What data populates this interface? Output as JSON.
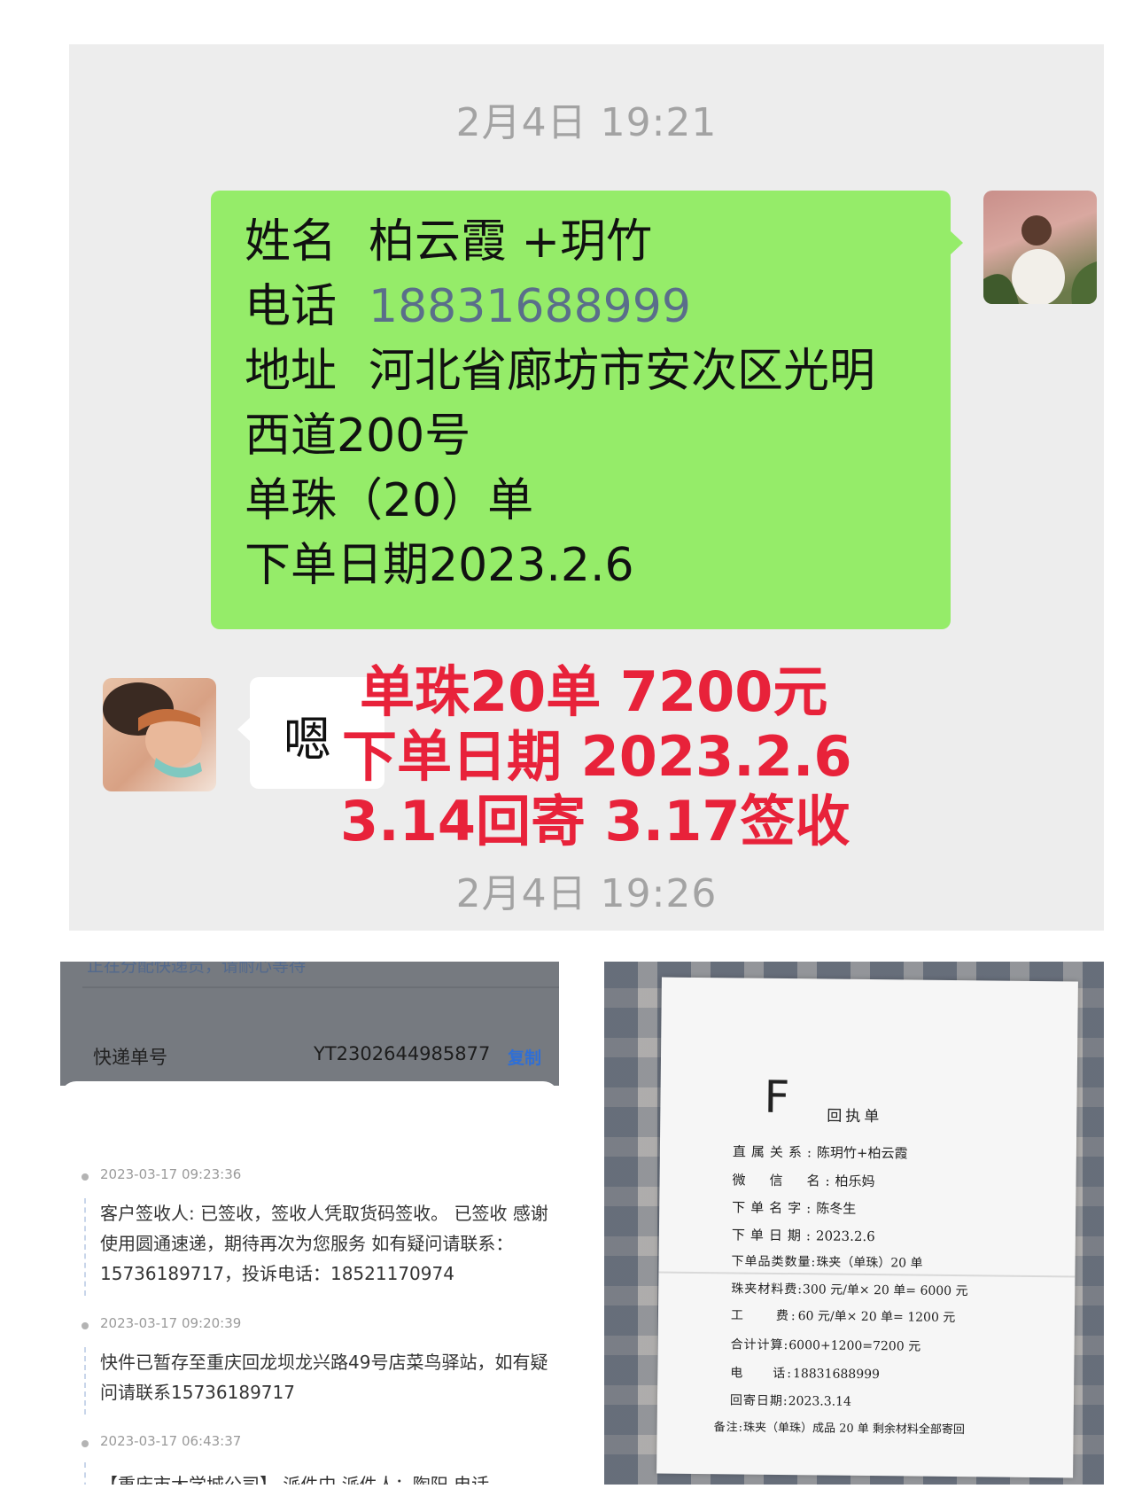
{
  "chat": {
    "timestamp_top": "2月4日 19:21",
    "outgoing": {
      "name_key": "姓名",
      "name_value": "柏云霞 +玥竹",
      "phone_key": "电话",
      "phone_value": "18831688999",
      "address_key": "地址",
      "address_value_line1": "河北省廊坊市安次区光明",
      "address_value_line2": "西道200号",
      "item_line": "单珠（20）单",
      "order_date_line": "下单日期2023.2.6"
    },
    "incoming_text": "嗯",
    "annotation": {
      "line1": "单珠20单 7200元",
      "line2": "下单日期 2023.2.6",
      "line3": "3.14回寄 3.17签收"
    },
    "timestamp_bottom": "2月4日 19:26"
  },
  "logistics": {
    "cut_text": "正在分配快递员，请耐心等待",
    "tracking_label": "快递单号",
    "tracking_number": "YT2302644985877",
    "copy_label": "复制",
    "events": [
      {
        "time": "2023-03-17 09:23:36",
        "text": "客户签收人: 已签收，签收人凭取货码签收。 已签收 感谢使用圆通速递，期待再次为您服务 如有疑问请联系：15736189717，投诉电话：18521170974"
      },
      {
        "time": "2023-03-17 09:20:39",
        "text": "快件已暂存至重庆回龙坝龙兴路49号店菜鸟驿站，如有疑问请联系15736189717"
      },
      {
        "time": "2023-03-17 06:43:37",
        "text": "【重庆市大学城公司】 派件中 派件人：陶阳 电话"
      }
    ]
  },
  "receipt": {
    "letter": "F",
    "heading": "回执单",
    "rows": [
      {
        "k": "直属关系:",
        "v": "陈玥竹+柏云霞"
      },
      {
        "k": "微　信　名:",
        "v": "柏乐妈"
      },
      {
        "k": "下单名字:",
        "v": "陈冬生"
      },
      {
        "k": "下单日期:",
        "v": "2023.2.6"
      },
      {
        "k": "下单品类数量:",
        "v": "珠夹（单珠）20 单"
      },
      {
        "k": "珠夹材料费:",
        "v": "300 元/单× 20 单= 6000 元"
      },
      {
        "k": "工　　费:",
        "v": "60 元/单× 20 单= 1200 元"
      },
      {
        "k": "合计计算:",
        "v": "6000+1200=7200 元"
      },
      {
        "k": "电　　话:",
        "v": "18831688999"
      },
      {
        "k": "回寄日期:",
        "v": "2023.3.14"
      },
      {
        "k": "备注:",
        "v": "珠夹（单珠）成品 20 单 剩余材料全部寄回"
      }
    ]
  },
  "colors": {
    "chat_bg": "#ededed",
    "bubble_green": "#95ec69",
    "annotation_red": "#e8223a",
    "copy_blue": "#2f6fd6"
  }
}
